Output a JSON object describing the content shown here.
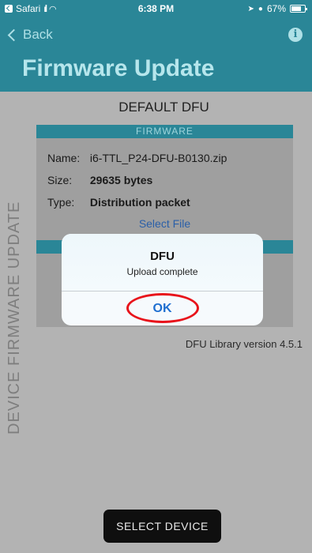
{
  "status_bar": {
    "back_app": "Safari",
    "signal": "……",
    "time": "6:38 PM",
    "battery": "67%",
    "icons": [
      "signal-icon",
      "wifi-icon",
      "location-icon",
      "alarm-icon",
      "battery-icon"
    ]
  },
  "nav": {
    "back_label": "Back",
    "title": "Firmware Update",
    "info_icon": "info-icon"
  },
  "side_label": "DEVICE FIRMWARE UPDATE",
  "section_title": "DEFAULT DFU",
  "firmware": {
    "header": "FIRMWARE",
    "name_label": "Name:",
    "name_value": "i6-TTL_P24-DFU-B0130.zip",
    "size_label": "Size:",
    "size_value": "29635 bytes",
    "type_label": "Type:",
    "type_value": "Distribution packet",
    "select_file": "Select File"
  },
  "library_version": "DFU Library version 4.5.1",
  "alert": {
    "title": "DFU",
    "message": "Upload complete",
    "ok_label": "OK"
  },
  "select_device_label": "SELECT DEVICE",
  "colors": {
    "header_bg": "#2a8697",
    "title": "#b6e6ec",
    "link": "#2a5fa8",
    "highlight_ring": "#e8131b"
  }
}
